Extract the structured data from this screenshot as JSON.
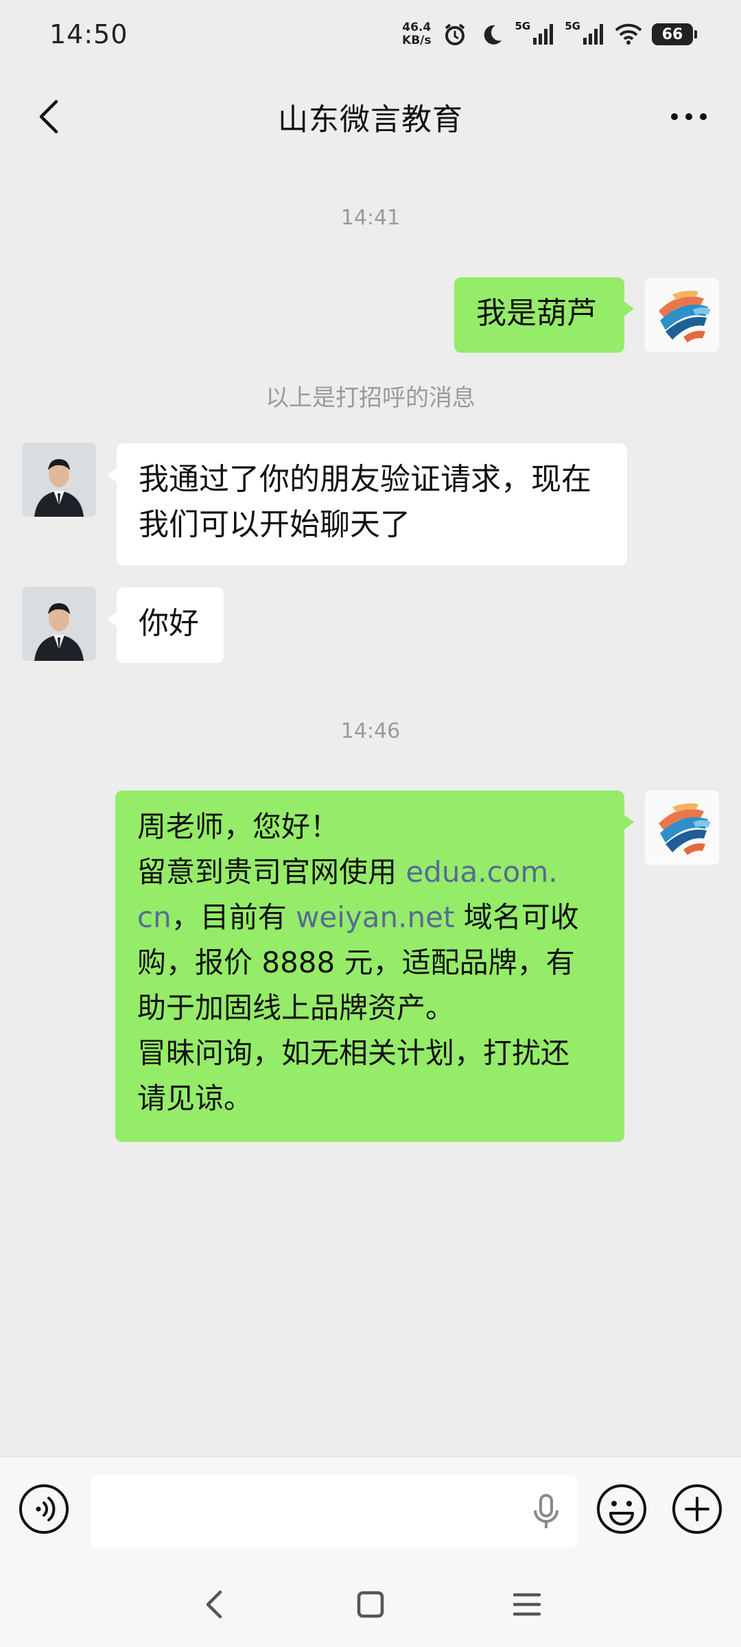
{
  "status_bar": {
    "time": "14:50",
    "net_speed_value": "46.4",
    "net_speed_unit": "KB/s",
    "signal_1_tag": "5G",
    "signal_2_tag": "5G",
    "battery": "66",
    "icons": [
      "alarm-icon",
      "moon-icon",
      "signal-icon",
      "signal-icon",
      "wifi-icon",
      "battery-icon"
    ]
  },
  "header": {
    "title": "山东微言教育",
    "back_icon": "chevron-left-icon",
    "more_icon": "more-dots-icon"
  },
  "chat": {
    "time_1": "14:41",
    "msg_out_1": "我是葫芦",
    "system_note": "以上是打招呼的消息",
    "msg_in_1_line_1": "我通过了你的朋友验证请求，现在",
    "msg_in_1_line_2": "我们可以开始聊天了",
    "msg_in_2": "你好",
    "time_2": "14:46",
    "msg_out_2": {
      "line_1": "周老师，您好！",
      "line_2_pre": "留意到贵司官网使用 ",
      "line_2_link": "edua.com.",
      "line_3_link": "cn",
      "line_3_mid": "，目前有 ",
      "line_3_link2": "weiyan.net",
      "line_3_post": " 域名可收",
      "line_4": "购，报价 8888 元，适配品牌，有",
      "line_5": "助于加固线上品牌资产。",
      "line_6": "冒昧问询，如无相关计划，打扰还",
      "line_7": "请见谅。"
    }
  },
  "input_bar": {
    "value": "",
    "placeholder": "",
    "icons": [
      "voice-icon",
      "mic-icon",
      "emoji-icon",
      "plus-icon"
    ]
  },
  "nav_bar": {
    "icons": [
      "nav-back-icon",
      "nav-home-icon",
      "nav-menu-icon"
    ]
  },
  "colors": {
    "background": "#ededed",
    "bubble_out": "#95ec69",
    "bubble_in": "#ffffff",
    "link": "#576b95",
    "meta_text": "#9a9a9a"
  }
}
